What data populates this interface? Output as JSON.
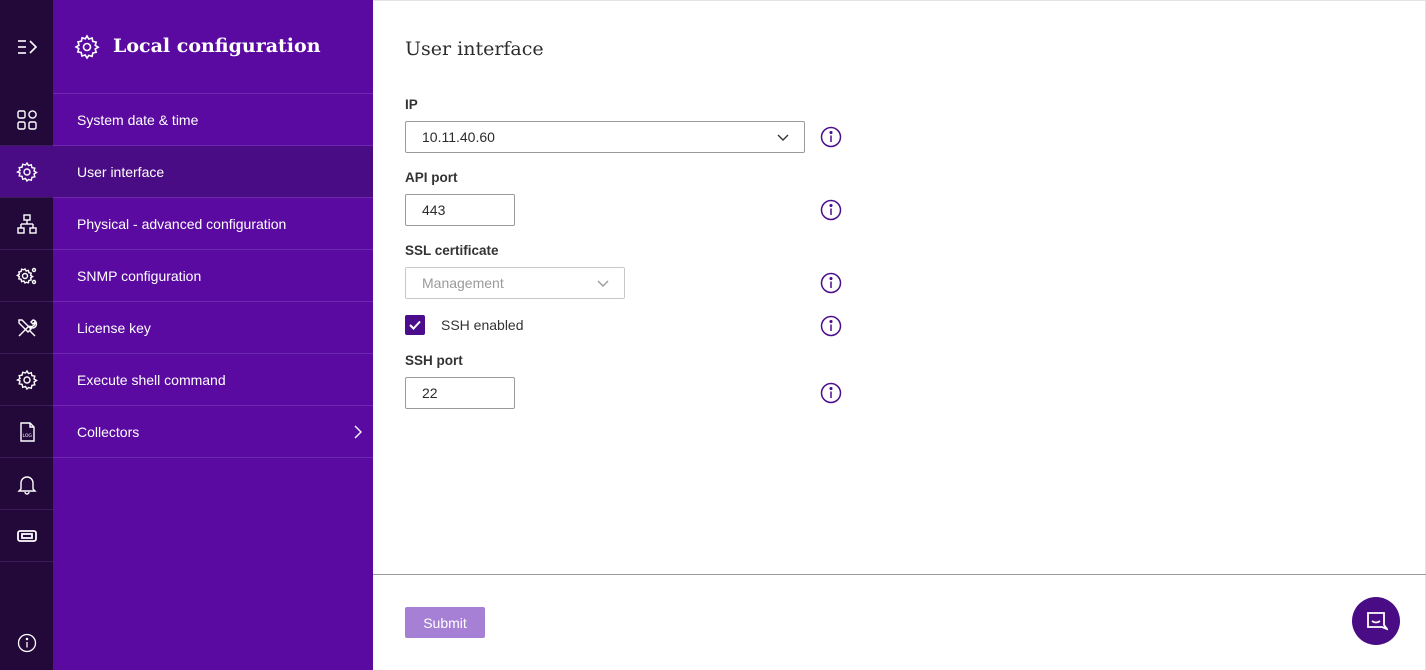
{
  "sidebar": {
    "title": "Local configuration",
    "items": [
      {
        "label": "System date & time",
        "active": false
      },
      {
        "label": "User interface",
        "active": true
      },
      {
        "label": "Physical - advanced configuration",
        "active": false
      },
      {
        "label": "SNMP configuration",
        "active": false
      },
      {
        "label": "License key",
        "active": false
      },
      {
        "label": "Execute shell command",
        "active": false
      },
      {
        "label": "Collectors",
        "active": false,
        "has_submenu": true
      }
    ]
  },
  "rail": {
    "icons": [
      "expand-menu-icon",
      "dashboard-grid-icon",
      "settings-gear-icon",
      "network-topology-icon",
      "snmp-gear-icon",
      "tools-icon",
      "gear-icon",
      "log-file-icon",
      "bell-icon",
      "ticket-icon",
      "info-icon"
    ]
  },
  "form": {
    "title": "User interface",
    "ip": {
      "label": "IP",
      "value": "10.11.40.60"
    },
    "api_port": {
      "label": "API port",
      "value": "443"
    },
    "ssl_certificate": {
      "label": "SSL certificate",
      "placeholder": "Management"
    },
    "ssh_enabled": {
      "label": "SSH enabled",
      "checked": true
    },
    "ssh_port": {
      "label": "SSH port",
      "value": "22"
    },
    "submit_label": "Submit"
  },
  "colors": {
    "rail_bg": "#23093a",
    "sidebar_bg": "#5a0aa0",
    "active_bg": "#4a0c85",
    "accent": "#4b0d8c",
    "submit_bg": "#a680d5"
  }
}
